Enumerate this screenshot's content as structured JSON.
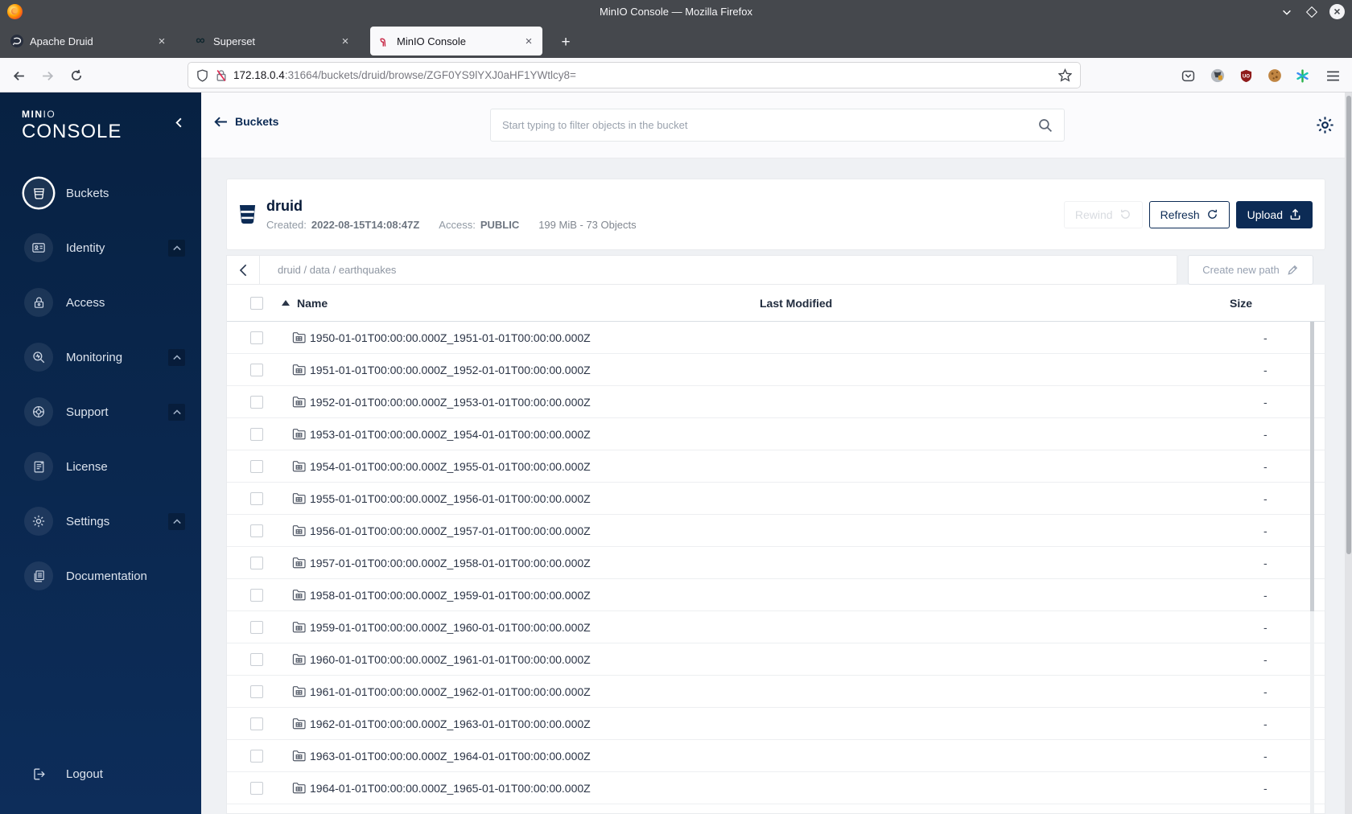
{
  "colors": {
    "accent_navy": "#0c2b55",
    "minio_red": "#c9304d",
    "sidebar_top": "#072142",
    "sidebar_bottom": "#0d2d5a",
    "page_bg": "#eff1f4"
  },
  "window": {
    "title": "MinIO Console — Mozilla Firefox"
  },
  "tabs": [
    {
      "label": "Apache Druid"
    },
    {
      "label": "Superset"
    },
    {
      "label": "MinIO Console"
    }
  ],
  "urlbar": {
    "host": "172.18.0.4",
    "rest": ":31664/buckets/druid/browse/ZGF0YS9lYXJ0aHF1YWtlcy8="
  },
  "sidebar": {
    "logo_bold": "MIN",
    "logo_light": "IO",
    "logo_main": "CONSOLE",
    "items": [
      {
        "label": "Buckets"
      },
      {
        "label": "Identity"
      },
      {
        "label": "Access"
      },
      {
        "label": "Monitoring"
      },
      {
        "label": "Support"
      },
      {
        "label": "License"
      },
      {
        "label": "Settings"
      },
      {
        "label": "Documentation"
      }
    ],
    "logout_label": "Logout"
  },
  "header": {
    "back_label": "Buckets",
    "search_placeholder": "Start typing to filter objects in the bucket"
  },
  "bucket": {
    "name": "druid",
    "created_label": "Created:",
    "created_value": "2022-08-15T14:08:47Z",
    "access_label": "Access:",
    "access_value": "PUBLIC",
    "usage": "199 MiB - 73 Objects",
    "rewind_label": "Rewind",
    "refresh_label": "Refresh",
    "upload_label": "Upload"
  },
  "browse": {
    "breadcrumb": "druid / data / earthquakes",
    "create_path_label": "Create new path",
    "columns": [
      "Name",
      "Last Modified",
      "Size"
    ],
    "rows": [
      {
        "name": "1950-01-01T00:00:00.000Z_1951-01-01T00:00:00.000Z",
        "size": "-"
      },
      {
        "name": "1951-01-01T00:00:00.000Z_1952-01-01T00:00:00.000Z",
        "size": "-"
      },
      {
        "name": "1952-01-01T00:00:00.000Z_1953-01-01T00:00:00.000Z",
        "size": "-"
      },
      {
        "name": "1953-01-01T00:00:00.000Z_1954-01-01T00:00:00.000Z",
        "size": "-"
      },
      {
        "name": "1954-01-01T00:00:00.000Z_1955-01-01T00:00:00.000Z",
        "size": "-"
      },
      {
        "name": "1955-01-01T00:00:00.000Z_1956-01-01T00:00:00.000Z",
        "size": "-"
      },
      {
        "name": "1956-01-01T00:00:00.000Z_1957-01-01T00:00:00.000Z",
        "size": "-"
      },
      {
        "name": "1957-01-01T00:00:00.000Z_1958-01-01T00:00:00.000Z",
        "size": "-"
      },
      {
        "name": "1958-01-01T00:00:00.000Z_1959-01-01T00:00:00.000Z",
        "size": "-"
      },
      {
        "name": "1959-01-01T00:00:00.000Z_1960-01-01T00:00:00.000Z",
        "size": "-"
      },
      {
        "name": "1960-01-01T00:00:00.000Z_1961-01-01T00:00:00.000Z",
        "size": "-"
      },
      {
        "name": "1961-01-01T00:00:00.000Z_1962-01-01T00:00:00.000Z",
        "size": "-"
      },
      {
        "name": "1962-01-01T00:00:00.000Z_1963-01-01T00:00:00.000Z",
        "size": "-"
      },
      {
        "name": "1963-01-01T00:00:00.000Z_1964-01-01T00:00:00.000Z",
        "size": "-"
      },
      {
        "name": "1964-01-01T00:00:00.000Z_1965-01-01T00:00:00.000Z",
        "size": "-"
      }
    ]
  }
}
